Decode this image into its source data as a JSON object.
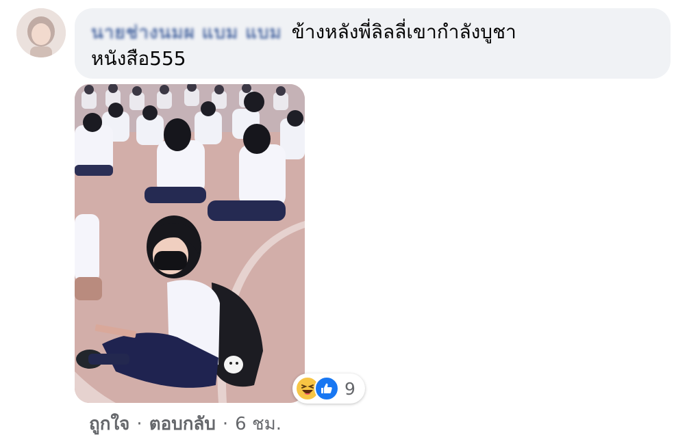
{
  "comment": {
    "author_name": "นายช่างนมผ แบม แบม",
    "text_line1": "ข้างหลังพี่ลิลลี่เขากำลังบูชา",
    "text_line2": "หนังสือ555"
  },
  "reactions": {
    "icons": [
      "haha-icon",
      "like-icon"
    ],
    "count": "9"
  },
  "actions": {
    "like_label": "ถูกใจ",
    "reply_label": "ตอบกลับ",
    "separator": "·",
    "timestamp": "6 ชม."
  },
  "colors": {
    "bubble_bg": "#f0f2f5",
    "author": "#385898",
    "text": "#050505",
    "meta": "#65676b",
    "like_blue": "#1877f2",
    "haha_yellow": "#f7c544"
  }
}
